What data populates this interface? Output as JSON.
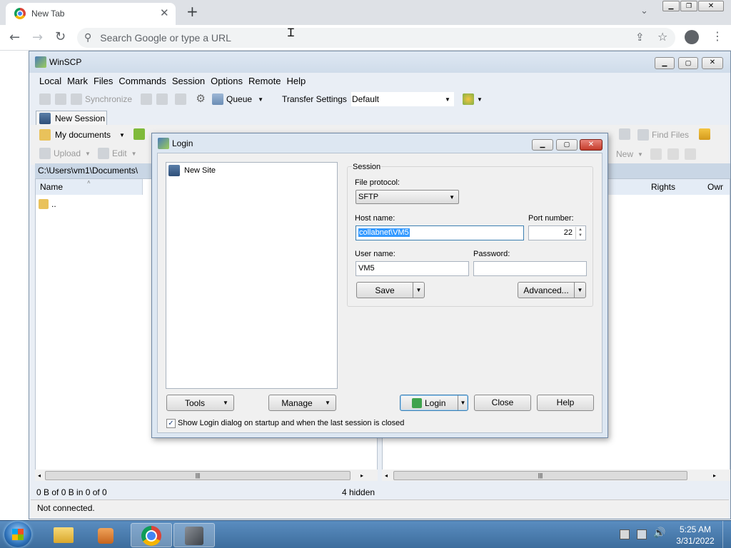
{
  "chrome": {
    "tab_title": "New Tab",
    "omnibox_placeholder": "Search Google or type a URL"
  },
  "winscp": {
    "title": "WinSCP",
    "menu": [
      "Local",
      "Mark",
      "Files",
      "Commands",
      "Session",
      "Options",
      "Remote",
      "Help"
    ],
    "toolbar": {
      "synchronize": "Synchronize",
      "queue": "Queue",
      "transfer_settings_label": "Transfer Settings",
      "transfer_settings_value": "Default"
    },
    "session_tab": "New Session",
    "local_panel": {
      "location": "My documents",
      "upload": "Upload",
      "edit": "Edit",
      "path": "C:\\Users\\vm1\\Documents\\",
      "column_name": "Name",
      "parent_dir": "..",
      "status": "0 B of 0 B in 0 of 0",
      "hidden": "4 hidden"
    },
    "remote_panel": {
      "find_files": "Find Files",
      "new": "New",
      "column_rights": "Rights",
      "column_owner": "Owr"
    },
    "status_bar": "Not connected."
  },
  "login": {
    "title": "Login",
    "site_tree": [
      "New Site"
    ],
    "session_group": "Session",
    "file_protocol_label": "File protocol:",
    "file_protocol_value": "SFTP",
    "host_name_label": "Host name:",
    "host_name_value": "collabnet\\VM5",
    "port_label": "Port number:",
    "port_value": "22",
    "user_label": "User name:",
    "user_value": "VM5",
    "password_label": "Password:",
    "password_value": "",
    "save_button": "Save",
    "advanced_button": "Advanced...",
    "tools_button": "Tools",
    "manage_button": "Manage",
    "login_button": "Login",
    "close_button": "Close",
    "help_button": "Help",
    "show_dialog_checkbox": "Show Login dialog on startup and when the last session is closed",
    "show_dialog_checked": true
  },
  "taskbar": {
    "time": "5:25 AM",
    "date": "3/31/2022"
  }
}
